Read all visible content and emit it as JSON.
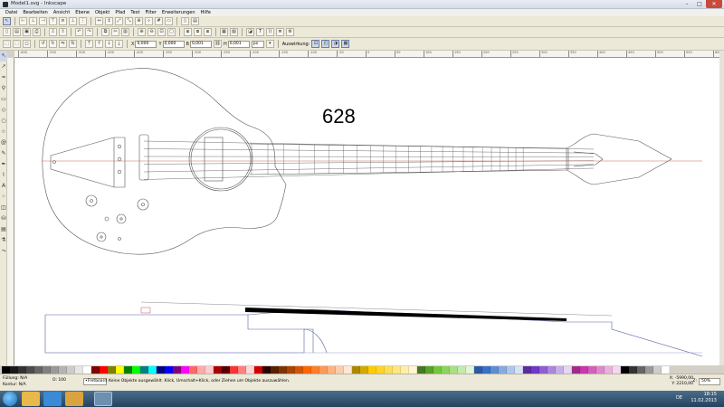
{
  "window": {
    "title": "Model1.svg - Inkscape"
  },
  "menu": [
    "Datei",
    "Bearbeiten",
    "Ansicht",
    "Ebene",
    "Objekt",
    "Pfad",
    "Text",
    "Filter",
    "Erweiterungen",
    "Hilfe"
  ],
  "toolbar": {
    "x_label": "X",
    "x_value": "0,000",
    "y_label": "Y",
    "y_value": "0,000",
    "w_label": "B",
    "w_value": "0,001",
    "h_label": "H",
    "h_value": "0,001",
    "unit": "px",
    "affect_label": "Auswirkung:"
  },
  "ruler_labels": [
    "-600",
    "-550",
    "-500",
    "-450",
    "-400",
    "-350",
    "-300",
    "-250",
    "-200",
    "-150",
    "-100",
    "-50",
    "0",
    "50",
    "100",
    "150",
    "200",
    "250",
    "300",
    "350",
    "400",
    "450",
    "500",
    "550",
    "600"
  ],
  "canvas": {
    "label_628": "628"
  },
  "palette": [
    "#000000",
    "#1a1a1a",
    "#333333",
    "#4d4d4d",
    "#666666",
    "#808080",
    "#999999",
    "#b3b3b3",
    "#cccccc",
    "#e6e6e6",
    "#ffffff",
    "#800000",
    "#ff0000",
    "#808000",
    "#ffff00",
    "#008000",
    "#00ff00",
    "#008080",
    "#00ffff",
    "#000080",
    "#0000ff",
    "#800080",
    "#ff00ff",
    "#ff6666",
    "#ffaaaa",
    "#ffcccc",
    "#aa0000",
    "#550000",
    "#ff3333",
    "#ff8080",
    "#ffd5d5",
    "#d40000",
    "#2b0000",
    "#552200",
    "#803300",
    "#aa4400",
    "#d45500",
    "#ff6600",
    "#ff7f2a",
    "#ff9955",
    "#ffb380",
    "#ffccaa",
    "#ffe6d5",
    "#aa8800",
    "#d4aa00",
    "#ffcc00",
    "#ffd42a",
    "#ffdd55",
    "#ffe680",
    "#ffeeaa",
    "#fff6d5",
    "#447821",
    "#5aa02c",
    "#71c837",
    "#8dd35f",
    "#aade87",
    "#c6e9af",
    "#e3f4d7",
    "#2c5aa0",
    "#3771c8",
    "#5f8dd3",
    "#87aade",
    "#afc6e9",
    "#d7e3f4",
    "#5a2ca0",
    "#7137c8",
    "#8d5fd3",
    "#aa87de",
    "#c6afe9",
    "#e3d7f4",
    "#a02c89",
    "#c837ab",
    "#d35fbc",
    "#de87cd",
    "#e9afdd",
    "#f4d7ee",
    "#000000",
    "#333333",
    "#666666",
    "#999999",
    "#cccccc",
    "#ffffff"
  ],
  "status": {
    "fill_label": "Füllung:",
    "fill_value": "N/A",
    "stroke_label": "Kontur:",
    "stroke_value": "N/A",
    "opacity_label": "O:",
    "opacity_value": "100",
    "layer": "•Fretboard",
    "message": "Keine Objekte ausgewählt. Klick, Umschalt+Klick, oder Ziehen um Objekte auszuwählen.",
    "x_coord": "X: -5990,00",
    "y_coord": "Y: 2210,00",
    "z_label": "Z:",
    "zoom": "50%"
  },
  "taskbar": {
    "lang": "DE",
    "time": "18:15",
    "date": "11.02.2013"
  }
}
